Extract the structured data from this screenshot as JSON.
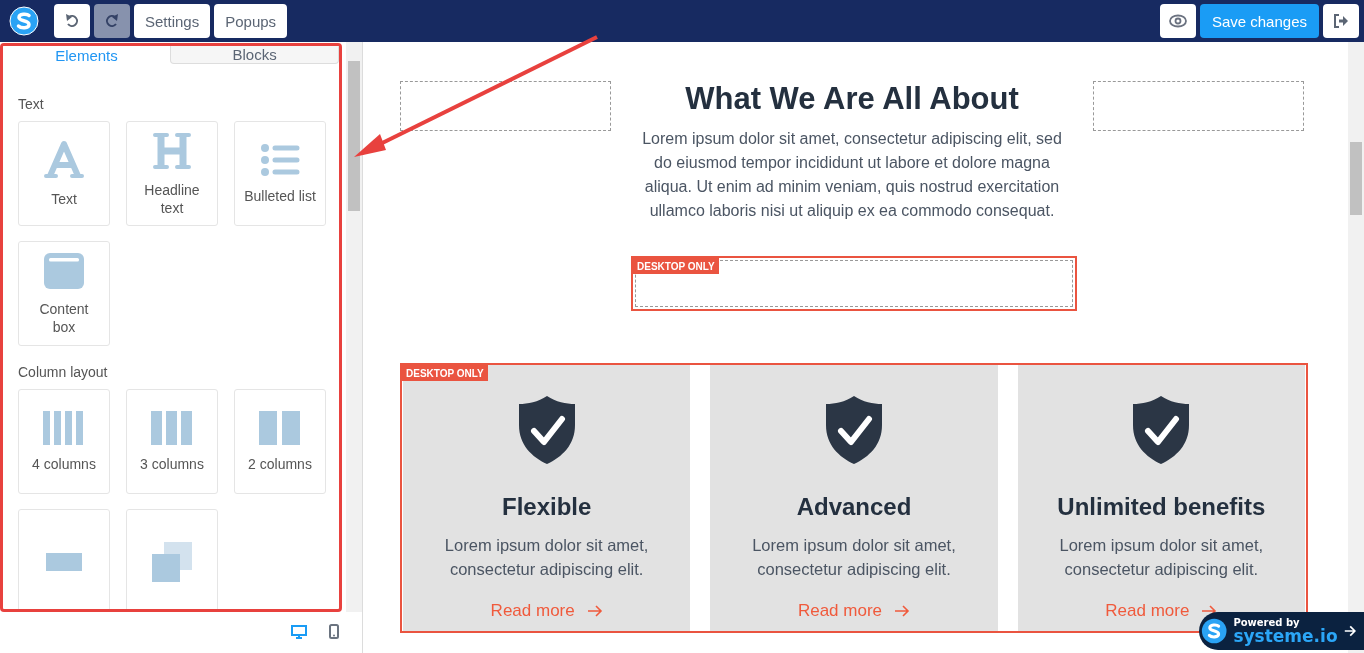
{
  "toolbar": {
    "left": [
      {
        "kind": "logo"
      },
      {
        "kind": "undo",
        "disabled": false
      },
      {
        "kind": "redo",
        "disabled": true
      },
      {
        "kind": "text",
        "label": "Settings",
        "disabled": false
      },
      {
        "kind": "text",
        "label": "Popups",
        "disabled": false
      }
    ],
    "right": [
      {
        "kind": "preview"
      },
      {
        "kind": "primary",
        "label": "Save changes"
      },
      {
        "kind": "exit"
      }
    ]
  },
  "sidebar": {
    "tabs": [
      {
        "label": "Elements",
        "selected": true
      },
      {
        "label": "Blocks",
        "selected": false
      }
    ],
    "sections": [
      {
        "title": "Text",
        "items": [
          {
            "kind": "text",
            "label": "Text"
          },
          {
            "kind": "headline",
            "label": "Headline text"
          },
          {
            "kind": "list",
            "label": "Bulleted list"
          },
          {
            "kind": "contentbox",
            "label": "Content box"
          }
        ]
      },
      {
        "title": "Column layout",
        "items": [
          {
            "kind": "col4",
            "label": "4 columns"
          },
          {
            "kind": "col3",
            "label": "3 columns"
          },
          {
            "kind": "col2",
            "label": "2 columns"
          },
          {
            "kind": "section"
          },
          {
            "kind": "popup"
          }
        ]
      }
    ],
    "devices": [
      {
        "kind": "desktop",
        "selected": true
      },
      {
        "kind": "mobile",
        "selected": false
      }
    ]
  },
  "page": {
    "heading": "What We Are All About",
    "paragraph": "Lorem ipsum dolor sit amet, consectetur adipiscing elit, sed do eiusmod tempor incididunt ut labore et dolore magna aliqua. Ut enim ad minim veniam, quis nostrud exercitation ullamco laboris nisi ut aliquip ex ea commodo consequat.",
    "empty_block_badge": "DESKTOP ONLY",
    "features": {
      "badge": "DESKTOP ONLY",
      "cards": [
        {
          "title": "Flexible",
          "text": "Lorem ipsum dolor sit amet, consectetur adipiscing elit.",
          "link": "Read more"
        },
        {
          "title": "Advanced",
          "text": "Lorem ipsum dolor sit amet, consectetur adipiscing elit.",
          "link": "Read more"
        },
        {
          "title": "Unlimited benefits",
          "text": "Lorem ipsum dolor sit amet, consectetur adipiscing elit.",
          "link": "Read more"
        }
      ]
    }
  },
  "powered_badge": {
    "line_1": "Powered by",
    "line_2": "systeme.io"
  }
}
